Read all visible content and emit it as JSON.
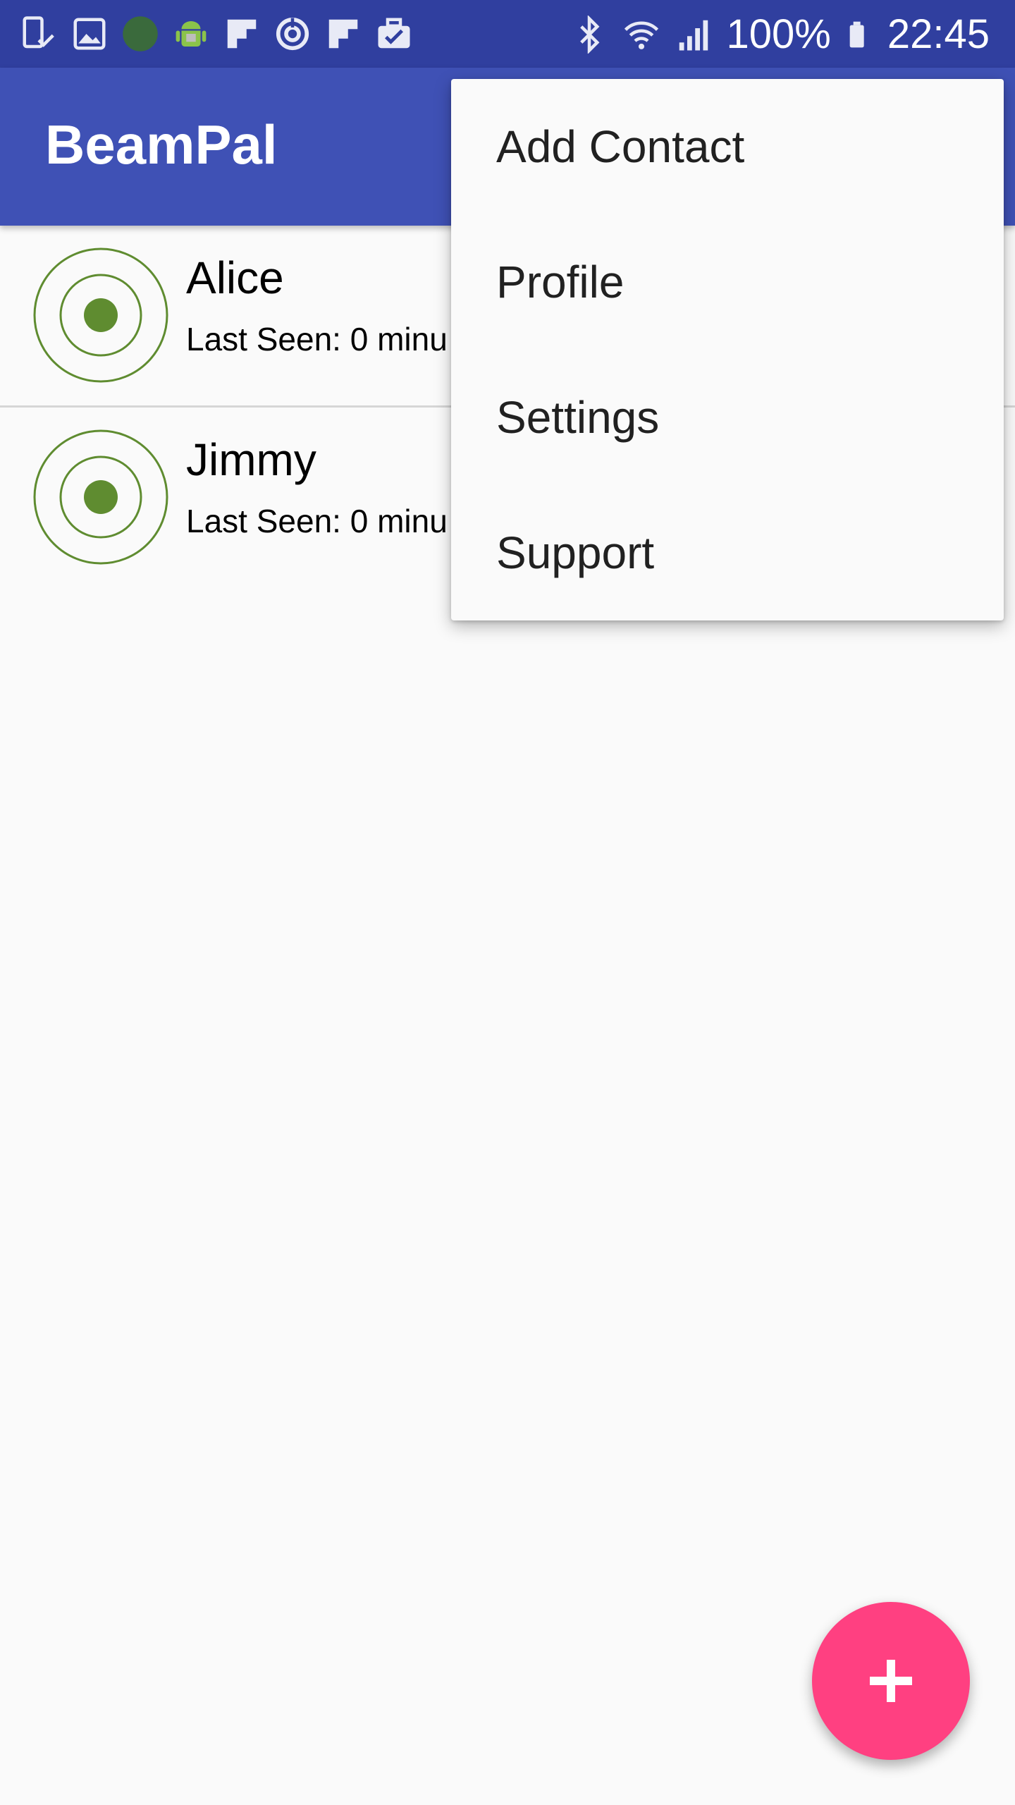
{
  "status_bar": {
    "left_icons": [
      "download-done-icon",
      "image-icon",
      "green-dot-icon",
      "android-icon",
      "flipboard-icon",
      "power-icon",
      "flipboard-icon",
      "briefcase-check-icon"
    ],
    "right_icons": [
      "bluetooth-icon",
      "wifi-icon",
      "signal-icon",
      "battery-icon"
    ],
    "battery": "100%",
    "time": "22:45"
  },
  "app_bar": {
    "title": "BeamPal"
  },
  "contacts": [
    {
      "name": "Alice",
      "status": "Last Seen: 0 minu",
      "avatar_icon": "beacon-icon"
    },
    {
      "name": "Jimmy",
      "status": "Last Seen: 0 minu",
      "avatar_icon": "beacon-icon"
    }
  ],
  "overflow_menu": {
    "items": [
      {
        "label": "Add Contact"
      },
      {
        "label": "Profile"
      },
      {
        "label": "Settings"
      },
      {
        "label": "Support"
      }
    ]
  },
  "fab": {
    "icon": "plus-icon"
  },
  "colors": {
    "status_bar": "#303f9f",
    "app_bar": "#3f51b5",
    "accent": "#ff4081",
    "beacon_green": "#5f8c30",
    "background": "#fafafa"
  }
}
